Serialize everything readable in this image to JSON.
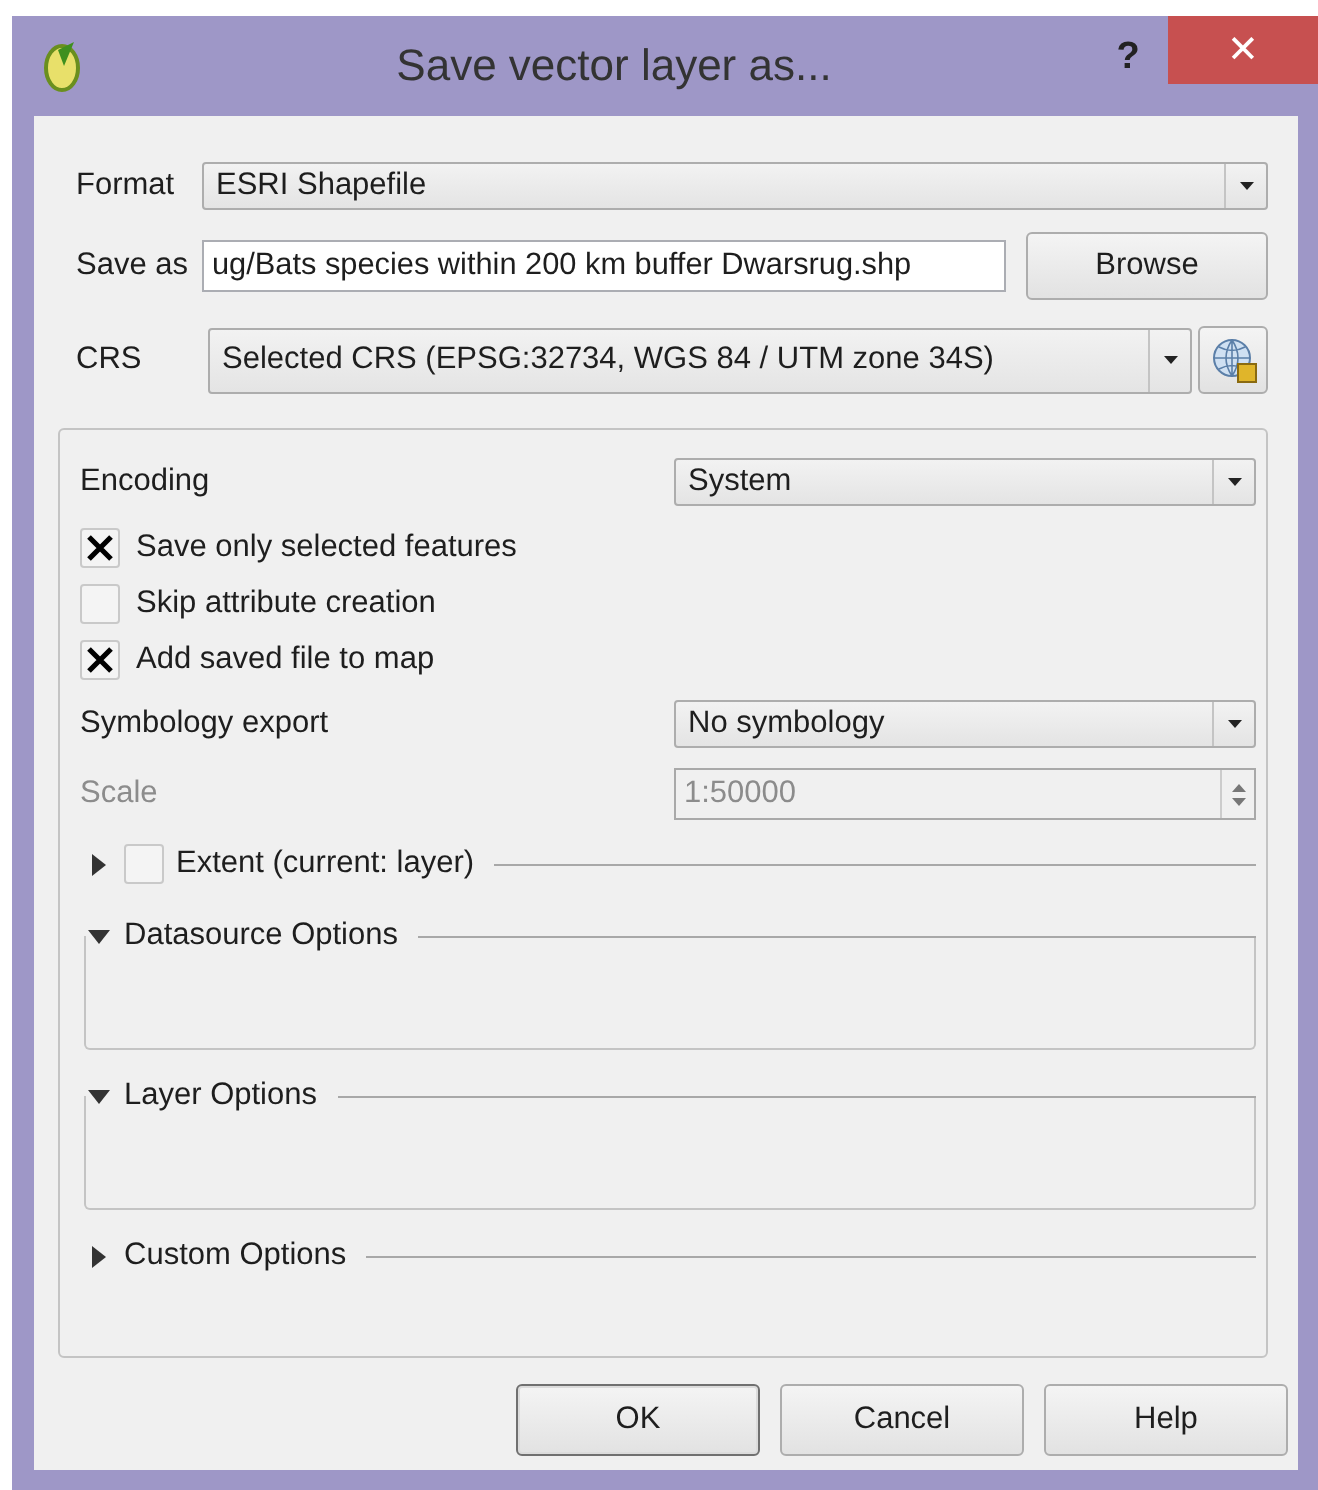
{
  "window": {
    "title": "Save vector layer as...",
    "help_button": "?",
    "close_button": "✕"
  },
  "format": {
    "label": "Format",
    "value": "ESRI Shapefile"
  },
  "save_as": {
    "label": "Save as",
    "value": "ug/Bats species within 200 km buffer Dwarsrug.shp",
    "button": "Browse"
  },
  "crs": {
    "label": "CRS",
    "value": "Selected CRS (EPSG:32734, WGS 84 / UTM zone 34S)"
  },
  "encoding": {
    "label": "Encoding",
    "value": "System"
  },
  "checkboxes": [
    {
      "label": "Save only selected features",
      "checked": true
    },
    {
      "label": "Skip attribute creation",
      "checked": false
    },
    {
      "label": "Add saved file to map",
      "checked": true
    }
  ],
  "symbology": {
    "label": "Symbology export",
    "value": "No symbology"
  },
  "scale": {
    "label": "Scale",
    "value": "1:50000",
    "disabled": true
  },
  "extent": {
    "label": "Extent (current: layer)",
    "expanded": false,
    "checked": false
  },
  "sections": [
    {
      "label": "Datasource Options",
      "expanded": true
    },
    {
      "label": "Layer Options",
      "expanded": true
    },
    {
      "label": "Custom Options",
      "expanded": false
    }
  ],
  "buttons": [
    {
      "label": "OK",
      "default": true
    },
    {
      "label": "Cancel",
      "default": false
    },
    {
      "label": "Help",
      "default": false
    }
  ]
}
